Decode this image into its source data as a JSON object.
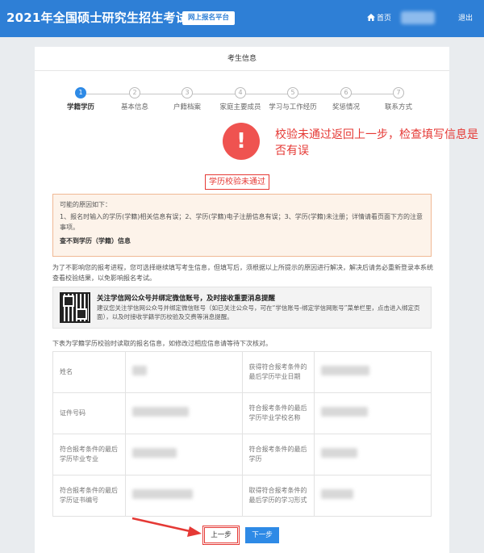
{
  "header": {
    "site_title": "2021年全国硕士研究生招生考试",
    "platform_badge": "网上报名平台",
    "home_label": "首页",
    "logout_label": "退出"
  },
  "page": {
    "section_title": "考生信息"
  },
  "steps": [
    {
      "number": "1",
      "label": "学籍学历",
      "active": true
    },
    {
      "number": "2",
      "label": "基本信息",
      "active": false
    },
    {
      "number": "3",
      "label": "户籍档案",
      "active": false
    },
    {
      "number": "4",
      "label": "家庭主要成员",
      "active": false
    },
    {
      "number": "5",
      "label": "学习与工作经历",
      "active": false
    },
    {
      "number": "6",
      "label": "奖惩情况",
      "active": false
    },
    {
      "number": "7",
      "label": "联系方式",
      "active": false
    }
  ],
  "alert": {
    "icon_glyph": "!",
    "annotation": "校验未通过返回上一步，检查填写信息是否有误",
    "title": "学历校验未通过"
  },
  "reasons": {
    "title": "可能的原因如下：",
    "text": "1、报名时输入的学历(学籍)相关信息有误；2、学历(学籍)电子注册信息有误；3、学历(学籍)未注册；详情请看页面下方的注意事项。",
    "link": "查不到学历（学籍）信息"
  },
  "note": "为了不影响您的报考进程，您可选择继续填写考生信息，但填写后，须根据以上所提示的原因进行解决，解决后请务必重新登录本系统查看校验结果，以免影响报名考试。",
  "wechat": {
    "title": "关注学信网公众号并绑定微信账号，及时接收重要消息提醒",
    "text": "建议您关注学信网公众号并绑定微信账号（如已关注公众号，可在“学信账号-绑定学信网账号”菜单栏里，点击进入绑定页面），以及时接收学籍学历校验及交费等消息提醒。"
  },
  "table": {
    "intro": "下表为学籍学历校验时读取的报名信息，如修改过相应信息请等待下次核对。",
    "rows": [
      {
        "left_label": "姓名",
        "right_label": "获得符合报考条件的最后学历毕业日期"
      },
      {
        "left_label": "证件号码",
        "right_label": "符合报考条件的最后学历毕业学校名称"
      },
      {
        "left_label": "符合报考条件的最后学历毕业专业",
        "right_label": "符合报考条件的最后学历"
      },
      {
        "left_label": "符合报考条件的最后学历证书编号",
        "right_label": "取得符合报考条件的最后学历的学习形式"
      }
    ]
  },
  "buttons": {
    "prev": "上一步",
    "next": "下一步"
  },
  "colors": {
    "brand_blue": "#2e7fd6",
    "button_blue": "#2e8ae6",
    "annotation_red": "#e53935",
    "alert_red": "#ef5350"
  }
}
